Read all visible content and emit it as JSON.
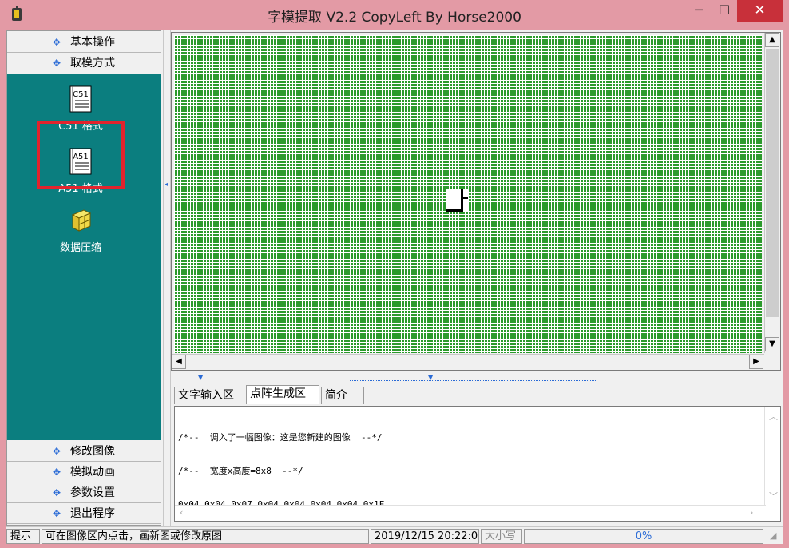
{
  "window": {
    "title": "字模提取 V2.2  CopyLeft By Horse2000",
    "minimize": "─",
    "maximize": "☐",
    "close": "✕"
  },
  "sidebar": {
    "top_sections": [
      {
        "label": "基本操作"
      },
      {
        "label": "取模方式"
      }
    ],
    "tools": [
      {
        "label": "C51 格式",
        "icon": "c51-doc-icon",
        "badge": "C51"
      },
      {
        "label": "A51 格式",
        "icon": "a51-doc-icon",
        "badge": "A51"
      },
      {
        "label": "数据压缩",
        "icon": "compress-box-icon"
      }
    ],
    "bottom_sections": [
      {
        "label": "修改图像"
      },
      {
        "label": "模拟动画"
      },
      {
        "label": "参数设置"
      },
      {
        "label": "退出程序"
      }
    ],
    "bullet": "✥"
  },
  "canvas": {
    "grid_color": "#2b9a2b",
    "highlight_color": "#e2242d"
  },
  "tabs": [
    {
      "label": "文字输入区",
      "active": false
    },
    {
      "label": "点阵生成区",
      "active": true
    },
    {
      "label": "简介",
      "active": false
    }
  ],
  "output": {
    "lines": [
      "/*--  调入了一幅图像：这是您新建的图像  --*/",
      "/*--  宽度x高度=8x8  --*/",
      "0x04,0x04,0x07,0x04,0x04,0x04,0x04,0x1F,"
    ]
  },
  "status": {
    "hint_label": "提示",
    "hint": "可在图像区内点击，画新图或修改原图",
    "datetime": "2019/12/15 20:22:05",
    "caps": "大小写",
    "progress": "0%"
  }
}
